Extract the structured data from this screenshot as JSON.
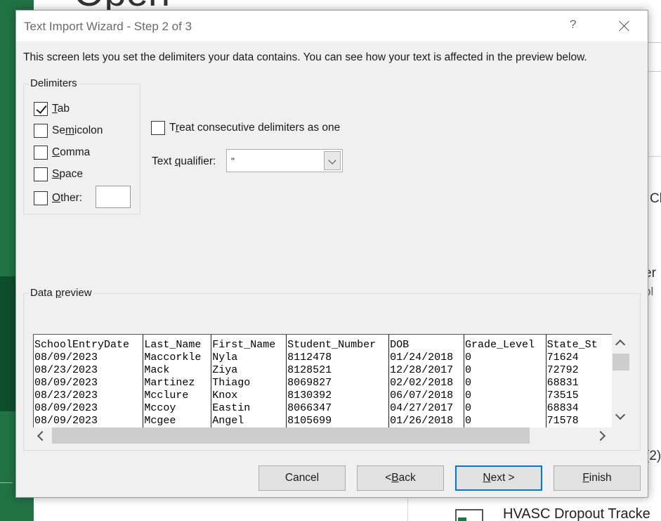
{
  "background": {
    "open_heading": "Open",
    "right_texts": [
      "Cl",
      "er",
      "ol",
      "(2)"
    ],
    "recent_file": "HVASC Dropout Tracke"
  },
  "dialog": {
    "title": "Text Import Wizard - Step 2 of 3",
    "help": "?",
    "intro": "This screen lets you set the delimiters your data contains.  You can see how your text is affected in the preview below.",
    "delimiters": {
      "label": "Delimiters",
      "tab": {
        "pre": "",
        "key": "T",
        "post": "ab",
        "checked": true
      },
      "semicolon": {
        "pre": "Se",
        "key": "m",
        "post": "icolon",
        "checked": false
      },
      "comma": {
        "pre": "",
        "key": "C",
        "post": "omma",
        "checked": false
      },
      "space": {
        "pre": "",
        "key": "S",
        "post": "pace",
        "checked": false
      },
      "other": {
        "pre": "",
        "key": "O",
        "post": "ther:",
        "checked": false,
        "value": ""
      }
    },
    "consecutive": {
      "pre": "T",
      "key": "r",
      "post": "eat consecutive delimiters as one",
      "checked": false
    },
    "qualifier": {
      "pre": "Text ",
      "key": "q",
      "post": "ualifier:",
      "value": "\""
    },
    "preview": {
      "label_pre": "Data ",
      "label_key": "p",
      "label_post": "review",
      "rows": [
        [
          "SchoolEntryDate",
          "Last_Name",
          "First_Name",
          "Student_Number",
          "DOB",
          "Grade_Level",
          "State_St"
        ],
        [
          "08/09/2023",
          "Maccorkle",
          "Nyla",
          "8112478",
          "01/24/2018",
          "0",
          "71624"
        ],
        [
          "08/23/2023",
          "Mack",
          "Ziya",
          "8128521",
          "12/28/2017",
          "0",
          "72792"
        ],
        [
          "08/09/2023",
          "Martinez",
          "Thiago",
          "8069827",
          "02/02/2018",
          "0",
          "68831"
        ],
        [
          "08/23/2023",
          "Mcclure",
          "Knox",
          "8130392",
          "06/07/2018",
          "0",
          "73515"
        ],
        [
          "08/09/2023",
          "Mccoy",
          "Eastin",
          "8066347",
          "04/27/2017",
          "0",
          "68834"
        ],
        [
          "08/09/2023",
          "Mcgee",
          "Angel",
          "8105699",
          "01/26/2018",
          "0",
          "71578"
        ]
      ]
    },
    "buttons": {
      "cancel": "Cancel",
      "back_pre": "< ",
      "back_key": "B",
      "back_post": "ack",
      "next_key": "N",
      "next_post": "ext >",
      "finish_key": "F",
      "finish_post": "inish"
    }
  }
}
